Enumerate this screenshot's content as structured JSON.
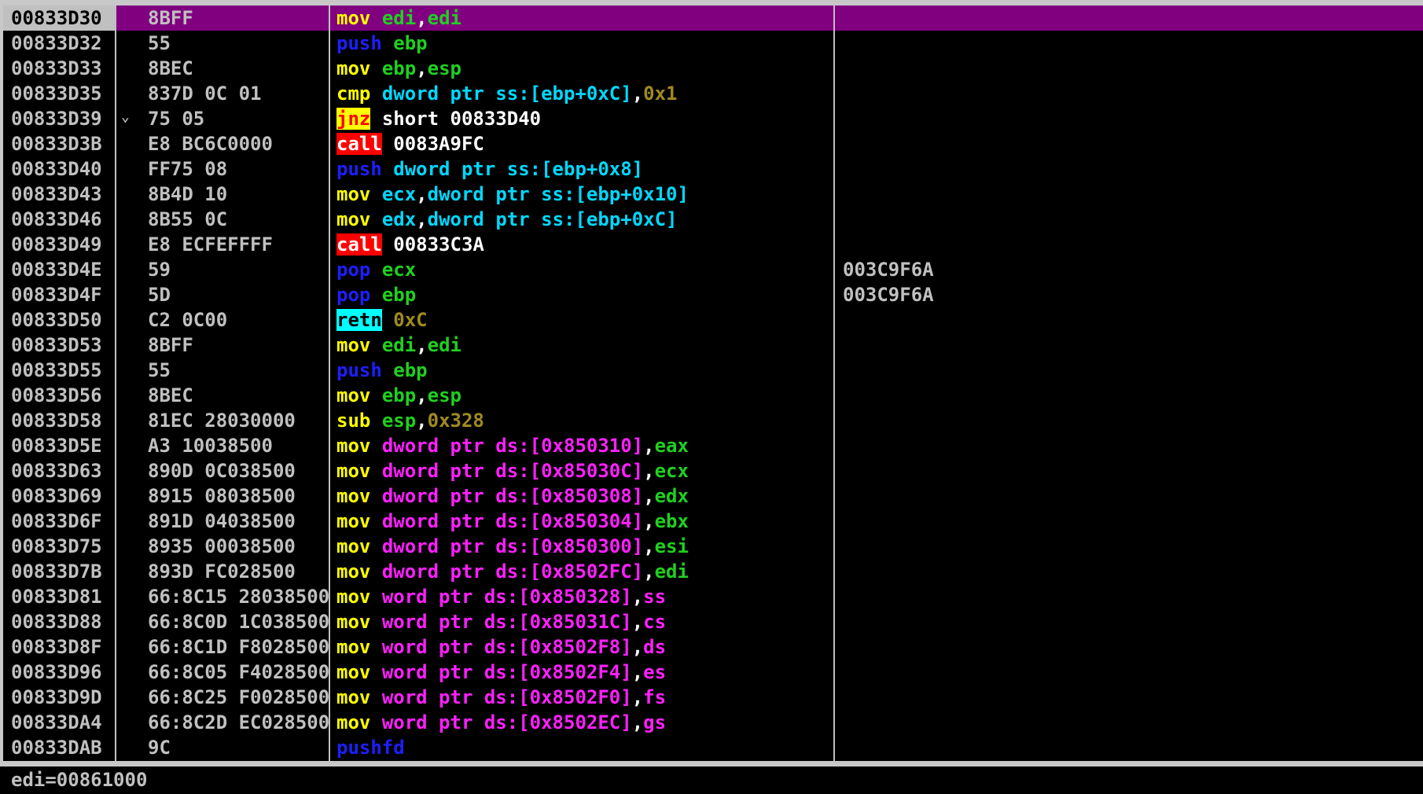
{
  "rows": [
    {
      "addr": "00833D30",
      "bytes": "8BFF",
      "jump_marker": "",
      "selected": true,
      "comment": "",
      "tokens": [
        {
          "t": "mov",
          "c": "mnem"
        },
        {
          "t": " "
        },
        {
          "t": "edi",
          "c": "reg"
        },
        {
          "t": ",",
          "c": "plain"
        },
        {
          "t": "edi",
          "c": "reg"
        }
      ]
    },
    {
      "addr": "00833D32",
      "bytes": "55",
      "jump_marker": "",
      "comment": "",
      "tokens": [
        {
          "t": "push",
          "c": "push"
        },
        {
          "t": " "
        },
        {
          "t": "ebp",
          "c": "reg"
        }
      ]
    },
    {
      "addr": "00833D33",
      "bytes": "8BEC",
      "jump_marker": "",
      "comment": "",
      "tokens": [
        {
          "t": "mov",
          "c": "mnem"
        },
        {
          "t": " "
        },
        {
          "t": "ebp",
          "c": "reg"
        },
        {
          "t": ",",
          "c": "plain"
        },
        {
          "t": "esp",
          "c": "reg"
        }
      ]
    },
    {
      "addr": "00833D35",
      "bytes": "837D 0C 01",
      "jump_marker": "",
      "comment": "",
      "tokens": [
        {
          "t": "cmp",
          "c": "mnem"
        },
        {
          "t": " "
        },
        {
          "t": "dword ptr ss:[ebp+0xC]",
          "c": "mem"
        },
        {
          "t": ",",
          "c": "plain"
        },
        {
          "t": "0x1",
          "c": "imm"
        }
      ]
    },
    {
      "addr": "00833D39",
      "bytes": "75 05",
      "jump_marker": "⌄",
      "comment": "",
      "tokens": [
        {
          "t": "jnz",
          "c": "jnz"
        },
        {
          "t": " "
        },
        {
          "t": "short 00833D40",
          "c": "plain"
        }
      ]
    },
    {
      "addr": "00833D3B",
      "bytes": "E8 BC6C0000",
      "jump_marker": "",
      "comment": "",
      "tokens": [
        {
          "t": "call",
          "c": "call"
        },
        {
          "t": " "
        },
        {
          "t": "0083A9FC",
          "c": "plain"
        }
      ]
    },
    {
      "addr": "00833D40",
      "bytes": "FF75 08",
      "jump_marker": "",
      "comment": "",
      "tokens": [
        {
          "t": "push",
          "c": "push"
        },
        {
          "t": " "
        },
        {
          "t": "dword ptr ss:[ebp+0x8]",
          "c": "mem"
        }
      ]
    },
    {
      "addr": "00833D43",
      "bytes": "8B4D 10",
      "jump_marker": "",
      "comment": "",
      "tokens": [
        {
          "t": "mov",
          "c": "mnem"
        },
        {
          "t": " "
        },
        {
          "t": "ecx",
          "c": "mem"
        },
        {
          "t": ",",
          "c": "plain"
        },
        {
          "t": "dword ptr ss:[ebp+0x10]",
          "c": "mem"
        }
      ]
    },
    {
      "addr": "00833D46",
      "bytes": "8B55 0C",
      "jump_marker": "",
      "comment": "",
      "tokens": [
        {
          "t": "mov",
          "c": "mnem"
        },
        {
          "t": " "
        },
        {
          "t": "edx",
          "c": "mem"
        },
        {
          "t": ",",
          "c": "plain"
        },
        {
          "t": "dword ptr ss:[ebp+0xC]",
          "c": "mem"
        }
      ]
    },
    {
      "addr": "00833D49",
      "bytes": "E8 ECFEFFFF",
      "jump_marker": "",
      "comment": "",
      "tokens": [
        {
          "t": "call",
          "c": "call"
        },
        {
          "t": " "
        },
        {
          "t": "00833C3A",
          "c": "plain"
        }
      ]
    },
    {
      "addr": "00833D4E",
      "bytes": "59",
      "jump_marker": "",
      "comment": "003C9F6A",
      "tokens": [
        {
          "t": "pop",
          "c": "push"
        },
        {
          "t": " "
        },
        {
          "t": "ecx",
          "c": "reg"
        }
      ]
    },
    {
      "addr": "00833D4F",
      "bytes": "5D",
      "jump_marker": "",
      "comment": "003C9F6A",
      "tokens": [
        {
          "t": "pop",
          "c": "push"
        },
        {
          "t": " "
        },
        {
          "t": "ebp",
          "c": "reg"
        }
      ]
    },
    {
      "addr": "00833D50",
      "bytes": "C2 0C00",
      "jump_marker": "",
      "comment": "",
      "tokens": [
        {
          "t": "retn",
          "c": "retn"
        },
        {
          "t": " "
        },
        {
          "t": "0xC",
          "c": "imm"
        }
      ]
    },
    {
      "addr": "00833D53",
      "bytes": "8BFF",
      "jump_marker": "",
      "comment": "",
      "tokens": [
        {
          "t": "mov",
          "c": "mnem"
        },
        {
          "t": " "
        },
        {
          "t": "edi",
          "c": "reg"
        },
        {
          "t": ",",
          "c": "plain"
        },
        {
          "t": "edi",
          "c": "reg"
        }
      ]
    },
    {
      "addr": "00833D55",
      "bytes": "55",
      "jump_marker": "",
      "comment": "",
      "tokens": [
        {
          "t": "push",
          "c": "push"
        },
        {
          "t": " "
        },
        {
          "t": "ebp",
          "c": "reg"
        }
      ]
    },
    {
      "addr": "00833D56",
      "bytes": "8BEC",
      "jump_marker": "",
      "comment": "",
      "tokens": [
        {
          "t": "mov",
          "c": "mnem"
        },
        {
          "t": " "
        },
        {
          "t": "ebp",
          "c": "reg"
        },
        {
          "t": ",",
          "c": "plain"
        },
        {
          "t": "esp",
          "c": "reg"
        }
      ]
    },
    {
      "addr": "00833D58",
      "bytes": "81EC 28030000",
      "jump_marker": "",
      "comment": "",
      "tokens": [
        {
          "t": "sub",
          "c": "mnem"
        },
        {
          "t": " "
        },
        {
          "t": "esp",
          "c": "reg"
        },
        {
          "t": ",",
          "c": "plain"
        },
        {
          "t": "0x328",
          "c": "imm"
        }
      ]
    },
    {
      "addr": "00833D5E",
      "bytes": "A3 10038500",
      "jump_marker": "",
      "comment": "",
      "tokens": [
        {
          "t": "mov",
          "c": "mnem"
        },
        {
          "t": " "
        },
        {
          "t": "dword ptr ds:[0x850310]",
          "c": "dsmem"
        },
        {
          "t": ",",
          "c": "plain"
        },
        {
          "t": "eax",
          "c": "reg"
        }
      ]
    },
    {
      "addr": "00833D63",
      "bytes": "890D 0C038500",
      "jump_marker": "",
      "comment": "",
      "tokens": [
        {
          "t": "mov",
          "c": "mnem"
        },
        {
          "t": " "
        },
        {
          "t": "dword ptr ds:[0x85030C]",
          "c": "dsmem"
        },
        {
          "t": ",",
          "c": "plain"
        },
        {
          "t": "ecx",
          "c": "reg"
        }
      ]
    },
    {
      "addr": "00833D69",
      "bytes": "8915 08038500",
      "jump_marker": "",
      "comment": "",
      "tokens": [
        {
          "t": "mov",
          "c": "mnem"
        },
        {
          "t": " "
        },
        {
          "t": "dword ptr ds:[0x850308]",
          "c": "dsmem"
        },
        {
          "t": ",",
          "c": "plain"
        },
        {
          "t": "edx",
          "c": "reg"
        }
      ]
    },
    {
      "addr": "00833D6F",
      "bytes": "891D 04038500",
      "jump_marker": "",
      "comment": "",
      "tokens": [
        {
          "t": "mov",
          "c": "mnem"
        },
        {
          "t": " "
        },
        {
          "t": "dword ptr ds:[0x850304]",
          "c": "dsmem"
        },
        {
          "t": ",",
          "c": "plain"
        },
        {
          "t": "ebx",
          "c": "reg"
        }
      ]
    },
    {
      "addr": "00833D75",
      "bytes": "8935 00038500",
      "jump_marker": "",
      "comment": "",
      "tokens": [
        {
          "t": "mov",
          "c": "mnem"
        },
        {
          "t": " "
        },
        {
          "t": "dword ptr ds:[0x850300]",
          "c": "dsmem"
        },
        {
          "t": ",",
          "c": "plain"
        },
        {
          "t": "esi",
          "c": "reg"
        }
      ]
    },
    {
      "addr": "00833D7B",
      "bytes": "893D FC028500",
      "jump_marker": "",
      "comment": "",
      "tokens": [
        {
          "t": "mov",
          "c": "mnem"
        },
        {
          "t": " "
        },
        {
          "t": "dword ptr ds:[0x8502FC]",
          "c": "dsmem"
        },
        {
          "t": ",",
          "c": "plain"
        },
        {
          "t": "edi",
          "c": "reg"
        }
      ]
    },
    {
      "addr": "00833D81",
      "bytes": "66:8C15 28038500",
      "jump_marker": "",
      "comment": "",
      "tokens": [
        {
          "t": "mov",
          "c": "mnem"
        },
        {
          "t": " "
        },
        {
          "t": "word ptr ds:[0x850328]",
          "c": "dsmem"
        },
        {
          "t": ",",
          "c": "plain"
        },
        {
          "t": "ss",
          "c": "dsmem"
        }
      ]
    },
    {
      "addr": "00833D88",
      "bytes": "66:8C0D 1C038500",
      "jump_marker": "",
      "comment": "",
      "tokens": [
        {
          "t": "mov",
          "c": "mnem"
        },
        {
          "t": " "
        },
        {
          "t": "word ptr ds:[0x85031C]",
          "c": "dsmem"
        },
        {
          "t": ",",
          "c": "plain"
        },
        {
          "t": "cs",
          "c": "dsmem"
        }
      ]
    },
    {
      "addr": "00833D8F",
      "bytes": "66:8C1D F8028500",
      "jump_marker": "",
      "comment": "",
      "tokens": [
        {
          "t": "mov",
          "c": "mnem"
        },
        {
          "t": " "
        },
        {
          "t": "word ptr ds:[0x8502F8]",
          "c": "dsmem"
        },
        {
          "t": ",",
          "c": "plain"
        },
        {
          "t": "ds",
          "c": "dsmem"
        }
      ]
    },
    {
      "addr": "00833D96",
      "bytes": "66:8C05 F4028500",
      "jump_marker": "",
      "comment": "",
      "tokens": [
        {
          "t": "mov",
          "c": "mnem"
        },
        {
          "t": " "
        },
        {
          "t": "word ptr ds:[0x8502F4]",
          "c": "dsmem"
        },
        {
          "t": ",",
          "c": "plain"
        },
        {
          "t": "es",
          "c": "dsmem"
        }
      ]
    },
    {
      "addr": "00833D9D",
      "bytes": "66:8C25 F0028500",
      "jump_marker": "",
      "comment": "",
      "tokens": [
        {
          "t": "mov",
          "c": "mnem"
        },
        {
          "t": " "
        },
        {
          "t": "word ptr ds:[0x8502F0]",
          "c": "dsmem"
        },
        {
          "t": ",",
          "c": "plain"
        },
        {
          "t": "fs",
          "c": "dsmem"
        }
      ]
    },
    {
      "addr": "00833DA4",
      "bytes": "66:8C2D EC028500",
      "jump_marker": "",
      "comment": "",
      "tokens": [
        {
          "t": "mov",
          "c": "mnem"
        },
        {
          "t": " "
        },
        {
          "t": "word ptr ds:[0x8502EC]",
          "c": "dsmem"
        },
        {
          "t": ",",
          "c": "plain"
        },
        {
          "t": "gs",
          "c": "dsmem"
        }
      ]
    },
    {
      "addr": "00833DAB",
      "bytes": "9C",
      "jump_marker": "",
      "comment": "",
      "tokens": [
        {
          "t": "pushfd",
          "c": "push"
        }
      ]
    }
  ],
  "status_bar": {
    "text": "edi=00861000"
  },
  "colors": {
    "background": "#000000",
    "selected_row": "#800080",
    "mnemonic": "#ffff00",
    "register": "#20d020",
    "memory_ss": "#00d8ff",
    "memory_ds": "#ff20ff",
    "immediate": "#a08a20",
    "call_highlight": "#ff0000",
    "retn_highlight": "#00ffff"
  }
}
